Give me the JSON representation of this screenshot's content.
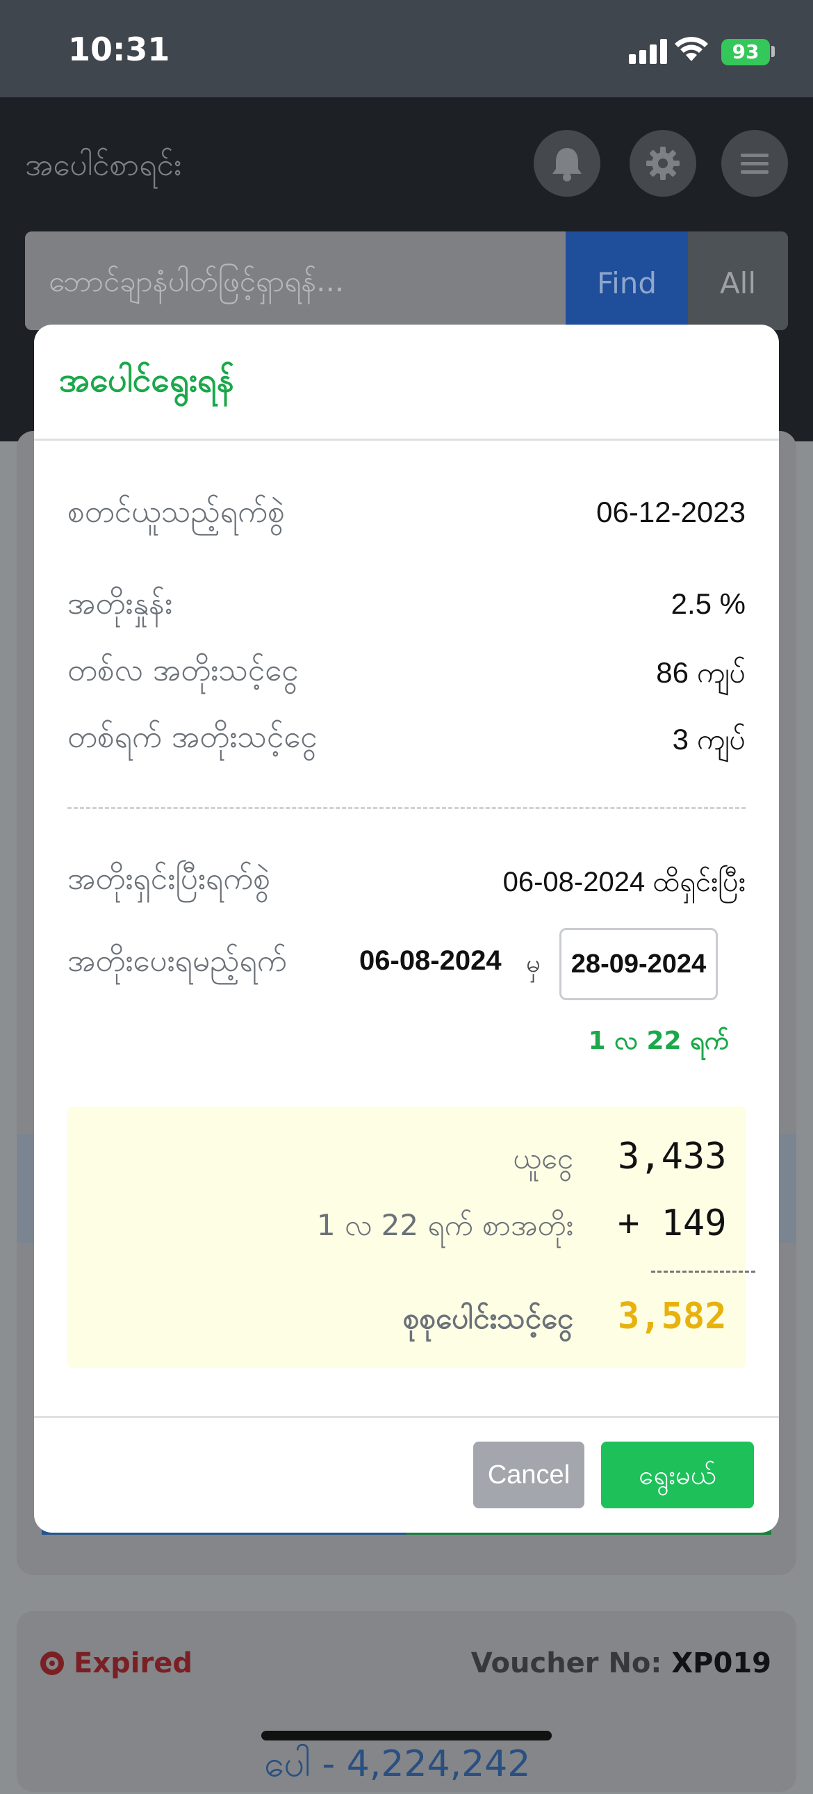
{
  "status_bar": {
    "time": "10:31",
    "battery": "93"
  },
  "app": {
    "title": "အပေါင်စာရင်း",
    "search": {
      "placeholder": "ဘောင်ချာနံပါတ်ဖြင့်ရှာရန်...",
      "find_label": "Find",
      "all_label": "All"
    }
  },
  "background_card": {
    "status_label": "Expired",
    "voucher_label": "Voucher No:",
    "voucher_no": "XP019",
    "amount_partial": "ပေါ - 4,224,242"
  },
  "modal": {
    "title": "အပေါင်ရွေးရန်",
    "info_rows": [
      {
        "label": "စတင်ယူသည့်ရက်စွဲ",
        "value": "06-12-2023"
      },
      {
        "label": "အတိုးနှုန်း",
        "value": "2.5 %"
      },
      {
        "label": "တစ်လ အတိုးသင့်ငွေ",
        "value": "86 ကျပ်"
      },
      {
        "label": "တစ်ရက် အတိုးသင့်ငွေ",
        "value": "3 ကျပ်"
      }
    ],
    "interest_paid": {
      "label": "အတိုးရှင်းပြီးရက်စွဲ",
      "value": "06-08-2024 ထိရှင်းပြီး"
    },
    "interest_due": {
      "label": "အတိုးပေးရမည့်ရက်",
      "from_date": "06-08-2024",
      "from_suffix": "မှ",
      "to_date": "28-09-2024"
    },
    "duration": "1 လ 22 ရက်",
    "summary": {
      "principal_label": "ယူငွေ",
      "principal_value": "3,433",
      "interest_label": "1 လ 22 ရက် စာအတိုး",
      "interest_value": "+ 149",
      "total_label": "စုစုပေါင်းသင့်ငွေ",
      "total_value": "3,582"
    },
    "cancel_label": "Cancel",
    "confirm_label": "ရွေးမယ်"
  },
  "colors": {
    "accent_green": "#1aa84a",
    "total_yellow": "#e8b20e",
    "primary_blue": "#2c5fbf"
  }
}
